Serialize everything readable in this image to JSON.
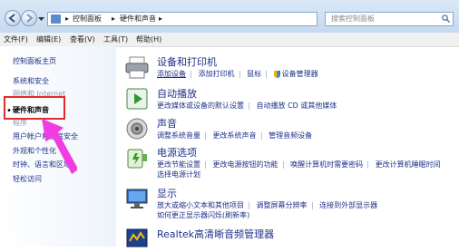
{
  "address_bar": {
    "crumbs": [
      "控制面板",
      "硬件和声音"
    ],
    "search_placeholder": "搜索控制面板"
  },
  "menu": [
    "文件(F)",
    "编辑(E)",
    "查看(V)",
    "工具(T)",
    "帮助(H)"
  ],
  "left_pane": {
    "items": [
      {
        "label": "控制面板主页"
      },
      {
        "label": "系统和安全"
      },
      {
        "label": "网络和 Internet"
      },
      {
        "label": "硬件和声音"
      },
      {
        "label": "程序"
      },
      {
        "label": "用户帐户和家庭安全"
      },
      {
        "label": "外观和个性化"
      },
      {
        "label": "时钟、语言和区域"
      },
      {
        "label": "轻松访问"
      }
    ]
  },
  "categories": [
    {
      "title": "设备和打印机",
      "icon": "printer-icon",
      "links": [
        "添加设备",
        "添加打印机",
        "鼠标",
        "设备管理器"
      ]
    },
    {
      "title": "自动播放",
      "icon": "autoplay-icon",
      "links": [
        "更改媒体或设备的默认设置",
        "自动播放 CD 或其他媒体"
      ]
    },
    {
      "title": "声音",
      "icon": "speaker-icon",
      "links": [
        "调整系统音量",
        "更改系统声音",
        "管理音频设备"
      ]
    },
    {
      "title": "电源选项",
      "icon": "power-icon",
      "links": [
        "更改节能设置",
        "更改电源按钮的功能",
        "唤醒计算机时需要密码",
        "更改计算机睡眠时间"
      ],
      "links2": [
        "选择电源计划"
      ]
    },
    {
      "title": "显示",
      "icon": "monitor-icon",
      "links": [
        "放大或缩小文本和其他项目",
        "调整屏幕分辨率",
        "连接到外部显示器"
      ],
      "links2": [
        "如何更正显示器闪烁(刷新率)"
      ]
    },
    {
      "title": "Realtek高清晰音频管理器",
      "icon": "realtek-icon",
      "links": []
    }
  ]
}
